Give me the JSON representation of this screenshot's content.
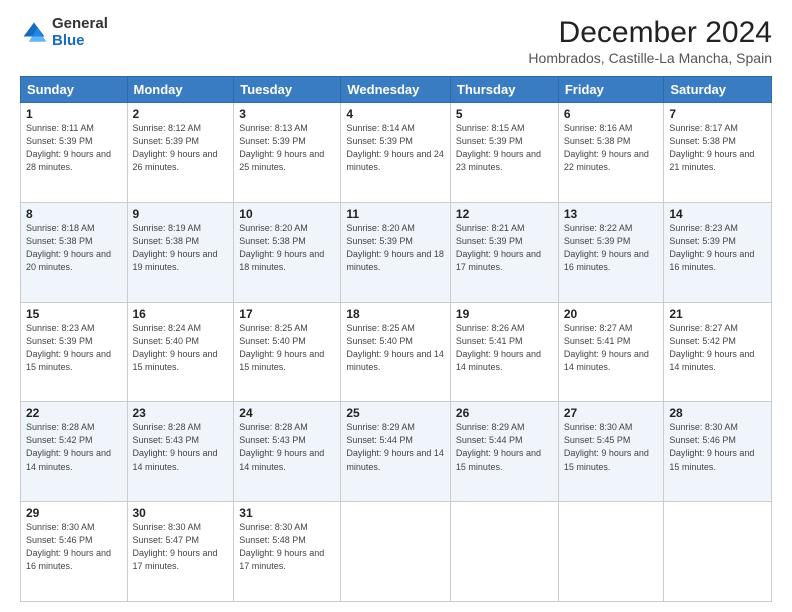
{
  "logo": {
    "general": "General",
    "blue": "Blue"
  },
  "title": "December 2024",
  "subtitle": "Hombrados, Castille-La Mancha, Spain",
  "days_of_week": [
    "Sunday",
    "Monday",
    "Tuesday",
    "Wednesday",
    "Thursday",
    "Friday",
    "Saturday"
  ],
  "weeks": [
    [
      {
        "day": "1",
        "sunrise": "8:11 AM",
        "sunset": "5:39 PM",
        "daylight": "9 hours and 28 minutes."
      },
      {
        "day": "2",
        "sunrise": "8:12 AM",
        "sunset": "5:39 PM",
        "daylight": "9 hours and 26 minutes."
      },
      {
        "day": "3",
        "sunrise": "8:13 AM",
        "sunset": "5:39 PM",
        "daylight": "9 hours and 25 minutes."
      },
      {
        "day": "4",
        "sunrise": "8:14 AM",
        "sunset": "5:39 PM",
        "daylight": "9 hours and 24 minutes."
      },
      {
        "day": "5",
        "sunrise": "8:15 AM",
        "sunset": "5:39 PM",
        "daylight": "9 hours and 23 minutes."
      },
      {
        "day": "6",
        "sunrise": "8:16 AM",
        "sunset": "5:38 PM",
        "daylight": "9 hours and 22 minutes."
      },
      {
        "day": "7",
        "sunrise": "8:17 AM",
        "sunset": "5:38 PM",
        "daylight": "9 hours and 21 minutes."
      }
    ],
    [
      {
        "day": "8",
        "sunrise": "8:18 AM",
        "sunset": "5:38 PM",
        "daylight": "9 hours and 20 minutes."
      },
      {
        "day": "9",
        "sunrise": "8:19 AM",
        "sunset": "5:38 PM",
        "daylight": "9 hours and 19 minutes."
      },
      {
        "day": "10",
        "sunrise": "8:20 AM",
        "sunset": "5:38 PM",
        "daylight": "9 hours and 18 minutes."
      },
      {
        "day": "11",
        "sunrise": "8:20 AM",
        "sunset": "5:39 PM",
        "daylight": "9 hours and 18 minutes."
      },
      {
        "day": "12",
        "sunrise": "8:21 AM",
        "sunset": "5:39 PM",
        "daylight": "9 hours and 17 minutes."
      },
      {
        "day": "13",
        "sunrise": "8:22 AM",
        "sunset": "5:39 PM",
        "daylight": "9 hours and 16 minutes."
      },
      {
        "day": "14",
        "sunrise": "8:23 AM",
        "sunset": "5:39 PM",
        "daylight": "9 hours and 16 minutes."
      }
    ],
    [
      {
        "day": "15",
        "sunrise": "8:23 AM",
        "sunset": "5:39 PM",
        "daylight": "9 hours and 15 minutes."
      },
      {
        "day": "16",
        "sunrise": "8:24 AM",
        "sunset": "5:40 PM",
        "daylight": "9 hours and 15 minutes."
      },
      {
        "day": "17",
        "sunrise": "8:25 AM",
        "sunset": "5:40 PM",
        "daylight": "9 hours and 15 minutes."
      },
      {
        "day": "18",
        "sunrise": "8:25 AM",
        "sunset": "5:40 PM",
        "daylight": "9 hours and 14 minutes."
      },
      {
        "day": "19",
        "sunrise": "8:26 AM",
        "sunset": "5:41 PM",
        "daylight": "9 hours and 14 minutes."
      },
      {
        "day": "20",
        "sunrise": "8:27 AM",
        "sunset": "5:41 PM",
        "daylight": "9 hours and 14 minutes."
      },
      {
        "day": "21",
        "sunrise": "8:27 AM",
        "sunset": "5:42 PM",
        "daylight": "9 hours and 14 minutes."
      }
    ],
    [
      {
        "day": "22",
        "sunrise": "8:28 AM",
        "sunset": "5:42 PM",
        "daylight": "9 hours and 14 minutes."
      },
      {
        "day": "23",
        "sunrise": "8:28 AM",
        "sunset": "5:43 PM",
        "daylight": "9 hours and 14 minutes."
      },
      {
        "day": "24",
        "sunrise": "8:28 AM",
        "sunset": "5:43 PM",
        "daylight": "9 hours and 14 minutes."
      },
      {
        "day": "25",
        "sunrise": "8:29 AM",
        "sunset": "5:44 PM",
        "daylight": "9 hours and 14 minutes."
      },
      {
        "day": "26",
        "sunrise": "8:29 AM",
        "sunset": "5:44 PM",
        "daylight": "9 hours and 15 minutes."
      },
      {
        "day": "27",
        "sunrise": "8:30 AM",
        "sunset": "5:45 PM",
        "daylight": "9 hours and 15 minutes."
      },
      {
        "day": "28",
        "sunrise": "8:30 AM",
        "sunset": "5:46 PM",
        "daylight": "9 hours and 15 minutes."
      }
    ],
    [
      {
        "day": "29",
        "sunrise": "8:30 AM",
        "sunset": "5:46 PM",
        "daylight": "9 hours and 16 minutes."
      },
      {
        "day": "30",
        "sunrise": "8:30 AM",
        "sunset": "5:47 PM",
        "daylight": "9 hours and 17 minutes."
      },
      {
        "day": "31",
        "sunrise": "8:30 AM",
        "sunset": "5:48 PM",
        "daylight": "9 hours and 17 minutes."
      },
      null,
      null,
      null,
      null
    ]
  ],
  "labels": {
    "sunrise": "Sunrise:",
    "sunset": "Sunset:",
    "daylight": "Daylight:"
  }
}
